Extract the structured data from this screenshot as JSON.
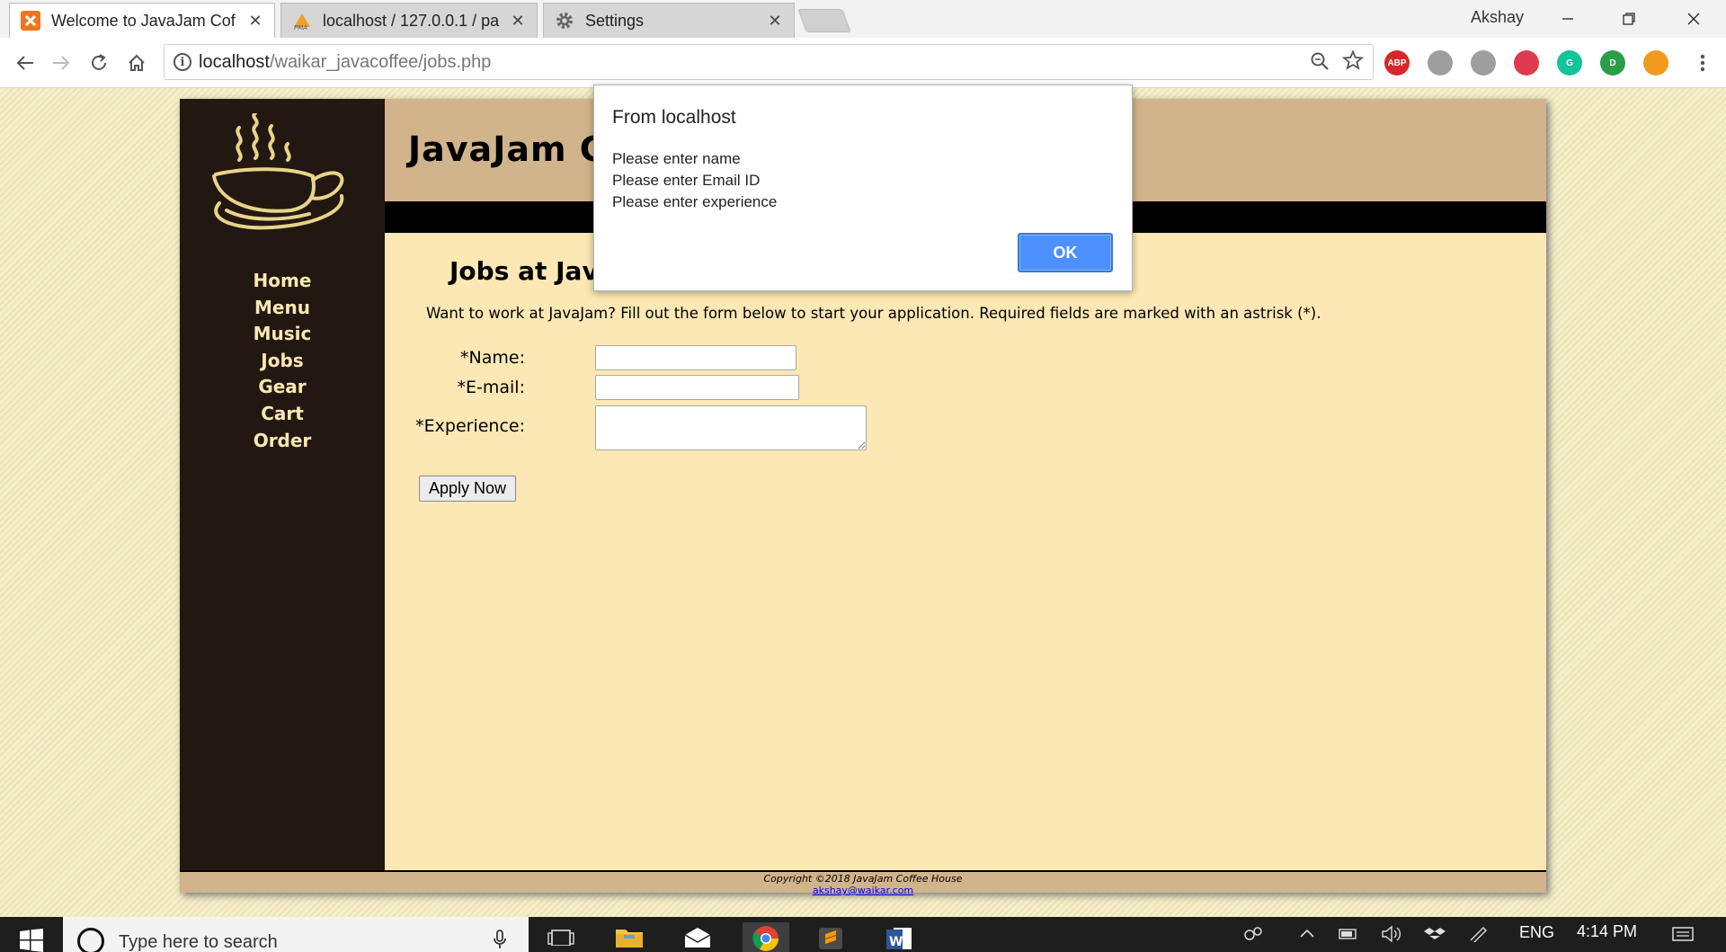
{
  "browser": {
    "tabs": [
      {
        "label": "Welcome to JavaJam Cof",
        "icon": "xampp-icon",
        "active": true
      },
      {
        "label": "localhost / 127.0.0.1 / pa",
        "icon": "phpmyadmin-icon",
        "active": false
      },
      {
        "label": "Settings",
        "icon": "gear-icon",
        "active": false
      }
    ],
    "close_glyph": "✕",
    "profile_name": "Akshay",
    "url_host": "localhost",
    "url_path": "/waikar_javacoffee/jobs.php",
    "extensions": [
      {
        "name": "abp-icon",
        "text": "ABP",
        "color": "#d9262c"
      },
      {
        "name": "clipboard-icon",
        "text": "",
        "color": "#9e9e9e"
      },
      {
        "name": "accessibility-icon",
        "text": "",
        "color": "#9e9e9e"
      },
      {
        "name": "pocket-icon",
        "text": "",
        "color": "#e03a4e"
      },
      {
        "name": "grammarly-icon",
        "text": "G",
        "color": "#15c39a"
      },
      {
        "name": "idm-icon",
        "text": "D",
        "color": "#2b9e47"
      },
      {
        "name": "hand-icon",
        "text": "",
        "color": "#f29a1f"
      }
    ]
  },
  "site": {
    "header_title": "JavaJam C",
    "nav": [
      "Home",
      "Menu",
      "Music",
      "Jobs",
      "Gear",
      "Cart",
      "Order"
    ],
    "page_heading": "Jobs at Jav",
    "intro": "Want to work at JavaJam? Fill out the form below to start your application. Required fields are marked with an astrisk (*).",
    "form": {
      "name_label": "*Name:",
      "email_label": "*E-mail:",
      "experience_label": "*Experience:",
      "name_value": "",
      "email_value": "",
      "experience_value": "",
      "submit_label": "Apply Now"
    },
    "footer": {
      "copyright": "Copyright ©2018 JavaJam Coffee House",
      "email": "akshay@waikar.com"
    },
    "colors": {
      "sidebar": "#231811",
      "header": "#d2b48c",
      "content": "#fce8b4",
      "nav_text": "#fce8b4"
    }
  },
  "dialog": {
    "title": "From localhost",
    "messages": [
      "Please enter name",
      "Please enter Email ID",
      "Please enter experience"
    ],
    "ok_label": "OK"
  },
  "taskbar": {
    "search_placeholder": "Type here to search",
    "language": "ENG",
    "time": "4:14 PM"
  }
}
